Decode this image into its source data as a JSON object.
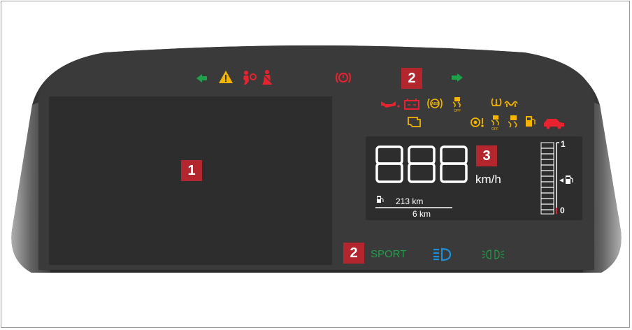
{
  "callouts": {
    "display_area": "1",
    "indicators_top": "2",
    "indicators_bottom": "2",
    "speed_display": "3"
  },
  "speed": {
    "digits": "888",
    "unit": "km/h"
  },
  "trip": {
    "range": "213 km",
    "odometer": "6 km"
  },
  "fuel_gauge": {
    "max_label": "1",
    "min_label": "0"
  },
  "bottom_indicators": {
    "sport_label": "SPORT"
  },
  "colors": {
    "green": "#1fa14a",
    "amber": "#f4b400",
    "red": "#e8232f",
    "blue": "#1c8fd8",
    "panel": "#343434",
    "shell": "#3a3a3a",
    "callout": "#b3262e"
  },
  "icons": {
    "top_row": [
      "turn-left-icon",
      "hazard-warning-icon",
      "airbag-icon",
      "seatbelt-icon",
      "brake-warning-icon",
      "turn-right-icon"
    ],
    "middle_row_red": [
      "oil-pressure-icon",
      "battery-icon"
    ],
    "middle_row_amber": [
      "abs-icon",
      "traction-control-off-icon",
      "tire-pressure-icon",
      "glow-plug-icon"
    ],
    "lower_row_amber": [
      "check-engine-icon",
      "steering-warning-icon",
      "esc-off-icon",
      "stability-control-icon",
      "low-fuel-icon"
    ],
    "lower_row_red": [
      "door-open-icon"
    ],
    "bottom_row": [
      "high-beam-icon",
      "fog-light-icon"
    ]
  }
}
